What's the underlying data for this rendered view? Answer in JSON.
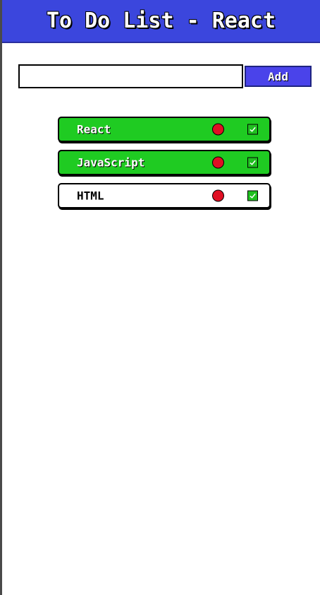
{
  "header": {
    "title": "To Do List - React"
  },
  "add_form": {
    "input_value": "",
    "input_placeholder": "",
    "button_label": "Add"
  },
  "todos": [
    {
      "text": "React",
      "done": true
    },
    {
      "text": "JavaScript",
      "done": true
    },
    {
      "text": "HTML",
      "done": false
    }
  ],
  "colors": {
    "header_bg": "#3b46dd",
    "add_button_bg": "#4a43ea",
    "done_bg": "#1fcb22",
    "delete_dot": "#e01024",
    "checkbox_bg": "#20c020"
  },
  "icons": {
    "delete": "delete-dot-icon",
    "check": "checkmark-icon"
  }
}
